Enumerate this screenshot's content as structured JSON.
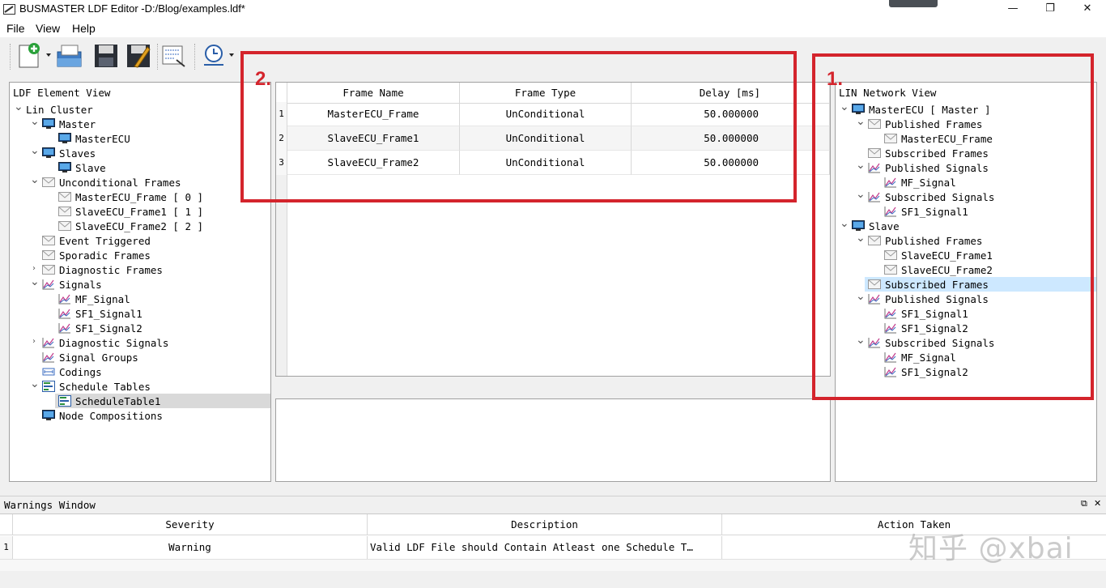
{
  "window": {
    "title": "BUSMASTER LDF Editor -D:/Blog/examples.ldf*",
    "controls": {
      "minimize": "—",
      "restore": "❐",
      "close": "✕"
    }
  },
  "menu": [
    "File",
    "View",
    "Help"
  ],
  "toolbar": {
    "buttons": [
      "new-icon",
      "open-icon",
      "save-icon",
      "save-as-icon",
      "export-icon",
      "schedule-icon"
    ]
  },
  "left_panel": {
    "title": "LDF Element View",
    "tree": [
      {
        "label": "Lin Cluster",
        "level": 0,
        "expander": "open",
        "icon": "none"
      },
      {
        "label": "Master",
        "level": 1,
        "expander": "open",
        "icon": "ecu-icon"
      },
      {
        "label": "MasterECU",
        "level": 2,
        "expander": "none",
        "icon": "ecu-icon"
      },
      {
        "label": "Slaves",
        "level": 1,
        "expander": "open",
        "icon": "ecu-icon"
      },
      {
        "label": "Slave",
        "level": 2,
        "expander": "none",
        "icon": "ecu-icon"
      },
      {
        "label": "Unconditional Frames",
        "level": 1,
        "expander": "open",
        "icon": "frame-icon"
      },
      {
        "label": "MasterECU_Frame [ 0 ]",
        "level": 2,
        "expander": "none",
        "icon": "frame-icon"
      },
      {
        "label": "SlaveECU_Frame1 [ 1 ]",
        "level": 2,
        "expander": "none",
        "icon": "frame-icon"
      },
      {
        "label": "SlaveECU_Frame2 [ 2 ]",
        "level": 2,
        "expander": "none",
        "icon": "frame-icon"
      },
      {
        "label": "Event Triggered",
        "level": 1,
        "expander": "none",
        "icon": "frame-icon"
      },
      {
        "label": "Sporadic Frames",
        "level": 1,
        "expander": "none",
        "icon": "frame-icon"
      },
      {
        "label": "Diagnostic Frames",
        "level": 1,
        "expander": "closed",
        "icon": "frame-icon"
      },
      {
        "label": "Signals",
        "level": 1,
        "expander": "open",
        "icon": "signal-icon"
      },
      {
        "label": "MF_Signal",
        "level": 2,
        "expander": "none",
        "icon": "signal-icon"
      },
      {
        "label": "SF1_Signal1",
        "level": 2,
        "expander": "none",
        "icon": "signal-icon"
      },
      {
        "label": "SF1_Signal2",
        "level": 2,
        "expander": "none",
        "icon": "signal-icon"
      },
      {
        "label": "Diagnostic Signals",
        "level": 1,
        "expander": "closed",
        "icon": "signal-icon"
      },
      {
        "label": "Signal Groups",
        "level": 1,
        "expander": "none",
        "icon": "signal-icon"
      },
      {
        "label": "Codings",
        "level": 1,
        "expander": "none",
        "icon": "coding-icon"
      },
      {
        "label": "Schedule Tables",
        "level": 1,
        "expander": "open",
        "icon": "schedule-table-icon"
      },
      {
        "label": "ScheduleTable1",
        "level": 2,
        "expander": "none",
        "icon": "schedule-table-icon",
        "selected": true
      },
      {
        "label": "Node Compositions",
        "level": 1,
        "expander": "none",
        "icon": "ecu-icon"
      }
    ]
  },
  "frame_table": {
    "columns": [
      "Frame Name",
      "Frame Type",
      "Delay [ms]"
    ],
    "rows": [
      {
        "num": "1",
        "name": "MasterECU_Frame",
        "type": "UnConditional",
        "delay": "50.000000"
      },
      {
        "num": "2",
        "name": "SlaveECU_Frame1",
        "type": "UnConditional",
        "delay": "50.000000"
      },
      {
        "num": "3",
        "name": "SlaveECU_Frame2",
        "type": "UnConditional",
        "delay": "50.000000"
      }
    ]
  },
  "right_panel": {
    "title": "LIN Network View",
    "tree": [
      {
        "label": "MasterECU [ Master ]",
        "level": 0,
        "expander": "open",
        "icon": "ecu-icon"
      },
      {
        "label": "Published Frames",
        "level": 1,
        "expander": "open",
        "icon": "frame-icon"
      },
      {
        "label": "MasterECU_Frame",
        "level": 2,
        "expander": "none",
        "icon": "frame-icon"
      },
      {
        "label": "Subscribed Frames",
        "level": 1,
        "expander": "none",
        "icon": "frame-icon"
      },
      {
        "label": "Published Signals",
        "level": 1,
        "expander": "open",
        "icon": "signal-icon"
      },
      {
        "label": "MF_Signal",
        "level": 2,
        "expander": "none",
        "icon": "signal-icon"
      },
      {
        "label": "Subscribed Signals",
        "level": 1,
        "expander": "open",
        "icon": "signal-icon"
      },
      {
        "label": "SF1_Signal1",
        "level": 2,
        "expander": "none",
        "icon": "signal-icon"
      },
      {
        "label": "Slave",
        "level": 0,
        "expander": "open",
        "icon": "ecu-icon"
      },
      {
        "label": "Published Frames",
        "level": 1,
        "expander": "open",
        "icon": "frame-icon"
      },
      {
        "label": "SlaveECU_Frame1",
        "level": 2,
        "expander": "none",
        "icon": "frame-icon"
      },
      {
        "label": "SlaveECU_Frame2",
        "level": 2,
        "expander": "none",
        "icon": "frame-icon"
      },
      {
        "label": "Subscribed Frames",
        "level": 1,
        "expander": "none",
        "icon": "frame-icon",
        "highlighted": true
      },
      {
        "label": "Published Signals",
        "level": 1,
        "expander": "open",
        "icon": "signal-icon"
      },
      {
        "label": "SF1_Signal1",
        "level": 2,
        "expander": "none",
        "icon": "signal-icon"
      },
      {
        "label": "SF1_Signal2",
        "level": 2,
        "expander": "none",
        "icon": "signal-icon"
      },
      {
        "label": "Subscribed Signals",
        "level": 1,
        "expander": "open",
        "icon": "signal-icon"
      },
      {
        "label": "MF_Signal",
        "level": 2,
        "expander": "none",
        "icon": "signal-icon"
      },
      {
        "label": "SF1_Signal2",
        "level": 2,
        "expander": "none",
        "icon": "signal-icon"
      }
    ]
  },
  "annotations": {
    "one": "1.",
    "two": "2.",
    "color": "#d4242c"
  },
  "warnings": {
    "title": "Warnings Window",
    "controls": {
      "float": "⧉",
      "close": "✕"
    },
    "columns": [
      "Severity",
      "Description",
      "Action Taken"
    ],
    "rows": [
      {
        "num": "1",
        "severity": "Warning",
        "description": "Valid LDF File should Contain Atleast one Schedule T…",
        "action": ""
      }
    ]
  },
  "watermark": "知乎 @xbai",
  "colors": {
    "selection": "#d9d9d9",
    "highlight": "#cde8ff",
    "annotation": "#d4242c"
  }
}
